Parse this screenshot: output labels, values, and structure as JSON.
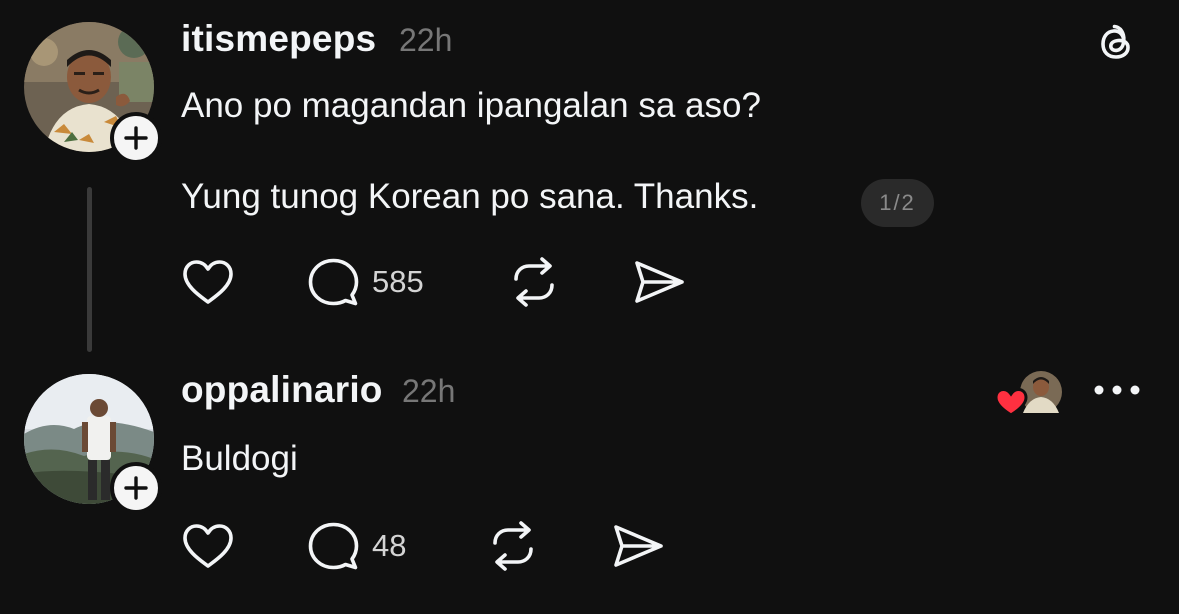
{
  "posts": [
    {
      "username": "itismepeps",
      "time": "22h",
      "lines": [
        "Ano po magandan ipangalan sa aso?",
        "Yung tunog Korean po sana. Thanks."
      ],
      "page_indicator": "1/2",
      "reply_count": "585"
    },
    {
      "username": "oppalinario",
      "time": "22h",
      "lines": [
        "Buldogi"
      ],
      "reply_count": "48"
    }
  ],
  "icons": {
    "app_logo": "threads-logo-icon",
    "like": "heart-icon",
    "reply": "speech-bubble-icon",
    "repost": "repost-icon",
    "share": "send-icon",
    "more": "more-horizontal-icon",
    "follow": "plus-icon"
  },
  "colors": {
    "background": "#101010",
    "text": "#f3f5f7",
    "muted": "#777777",
    "badge_bg": "#2a2a2a",
    "liked_heart": "#ff3040"
  }
}
